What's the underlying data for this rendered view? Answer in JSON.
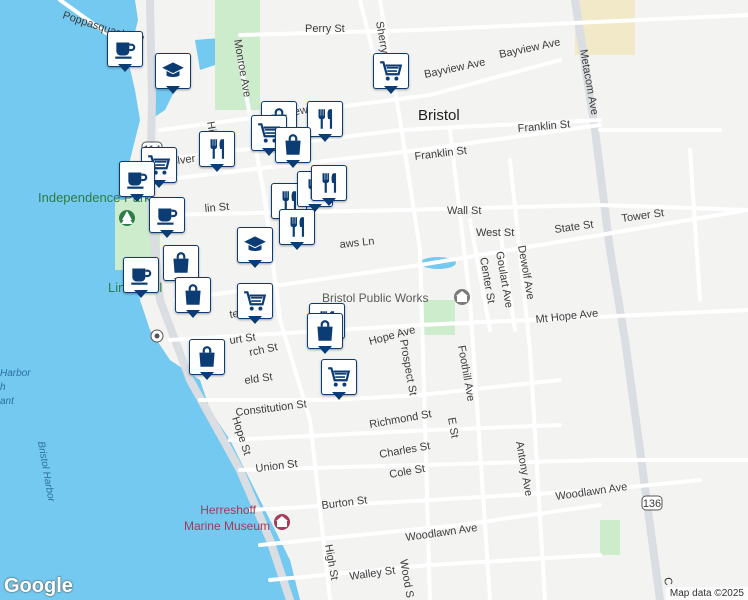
{
  "map": {
    "city_label": "Bristol",
    "landmarks": {
      "park": "Independence Park",
      "lind": "Linden Pl",
      "public_works": "Bristol Public Works",
      "museum_line1": "Herreshoff",
      "museum_line2": "Marine Museum"
    },
    "water_labels": {
      "harbor": "Bristol Harbor",
      "harbor_l1": "Harbor",
      "harbor_l2": "h",
      "harbor_l3": "ant"
    },
    "shields": [
      "114",
      "136"
    ],
    "streets": {
      "poppasquash": "Poppasquash Rd",
      "perry": "Perry St",
      "bayview_e": "Bayview Ave",
      "bayview_e2": "Bayview Ave",
      "bayview_w": "Bayview Ave",
      "sherry": "Sherry Ave",
      "metacom": "Metacom Ave",
      "monroe": "Monroe Ave",
      "high_n": "High",
      "high_s": "High St",
      "franklin_e": "Franklin St",
      "franklin_m": "Franklin St",
      "franklin_w": "olver St",
      "bradford": "lin St",
      "wall": "Wall St",
      "west": "West St",
      "state": "State St",
      "tower": "Tower St",
      "dewolf": "Dewolf Ave",
      "goulart": "Goulart Ave",
      "center": "Center St",
      "mthope_e": "Mt Hope Ave",
      "mthope_w": "Hope Ave",
      "church": "rch St",
      "court": "urt St",
      "field": "eld St",
      "shaws": "aws Ln",
      "te": "te St",
      "prospect": "Prospect St",
      "foothill": "Foothill Ave",
      "constitution": "Constitution St",
      "richmond": "Richmond St",
      "e_st": "E St",
      "charles": "Charles St",
      "union": "Union St",
      "cole": "Cole St",
      "antony": "Antony Ave",
      "burton": "Burton St",
      "woodlawn_e": "Woodlawn Ave",
      "woodlawn_w": "Woodlawn Ave",
      "hope_st": "Hope St",
      "walley": "Walley St",
      "wood": "Wood S",
      "c_bottom": "C"
    }
  },
  "markers": [
    {
      "type": "coffee-icon",
      "name": "marker-coffee-1"
    },
    {
      "type": "school-icon",
      "name": "marker-school-1"
    },
    {
      "type": "cart-icon",
      "name": "marker-cart-1"
    },
    {
      "type": "bag-icon",
      "name": "marker-bag-1"
    },
    {
      "type": "restaurant-icon",
      "name": "marker-restaurant-1"
    },
    {
      "type": "cart-icon",
      "name": "marker-cart-2"
    },
    {
      "type": "bag-icon",
      "name": "marker-bag-2"
    },
    {
      "type": "restaurant-icon",
      "name": "marker-restaurant-2"
    },
    {
      "type": "cart-icon",
      "name": "marker-cart-3"
    },
    {
      "type": "coffee-icon",
      "name": "marker-coffee-2"
    },
    {
      "type": "restaurant-icon",
      "name": "marker-restaurant-3"
    },
    {
      "type": "restaurant-icon",
      "name": "marker-restaurant-4"
    },
    {
      "type": "restaurant-icon",
      "name": "marker-restaurant-5"
    },
    {
      "type": "coffee-icon",
      "name": "marker-coffee-3"
    },
    {
      "type": "restaurant-icon",
      "name": "marker-restaurant-6"
    },
    {
      "type": "school-icon",
      "name": "marker-school-2"
    },
    {
      "type": "bag-icon",
      "name": "marker-bag-3"
    },
    {
      "type": "coffee-icon",
      "name": "marker-coffee-4"
    },
    {
      "type": "bag-icon",
      "name": "marker-bag-4"
    },
    {
      "type": "cart-icon",
      "name": "marker-cart-4"
    },
    {
      "type": "restaurant-icon",
      "name": "marker-restaurant-7"
    },
    {
      "type": "bag-icon",
      "name": "marker-bag-5"
    },
    {
      "type": "bag-icon",
      "name": "marker-bag-6"
    },
    {
      "type": "cart-icon",
      "name": "marker-cart-5"
    }
  ],
  "attribution": {
    "logo": "Google",
    "text": "Map data ©2025"
  },
  "colors": {
    "water": "#73c9ef",
    "marker_border": "#0b3c73",
    "park": "#cdeccc",
    "road": "#ffffff",
    "highway": "#dadde1"
  }
}
